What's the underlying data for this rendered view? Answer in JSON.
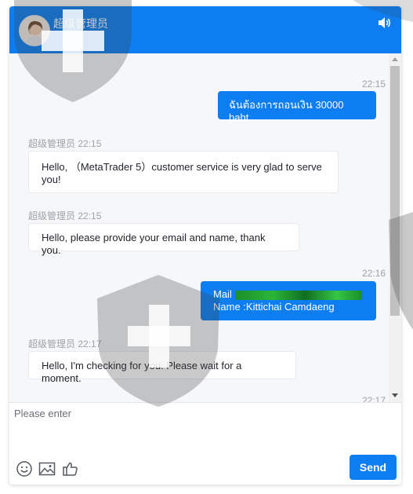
{
  "header": {
    "agent_name": "超级管理员",
    "sound_icon": "speaker-icon",
    "background": "#0d7ef2"
  },
  "messages": [
    {
      "side": "out",
      "time": "22:15",
      "text": "ฉันต้องการถอนเงิน 30000 baht."
    },
    {
      "side": "in",
      "sender": "超级管理员",
      "time": "22:15",
      "text": "Hello, （MetaTrader 5）customer service is very glad to serve you!"
    },
    {
      "side": "in",
      "sender": "超级管理员",
      "time": "22:15",
      "text": "Hello, please provide your email and name, thank you."
    },
    {
      "side": "out",
      "time": "22:16",
      "line1_label": "Mail",
      "line1_value": "[redacted email]",
      "line2": "Name :Kittichai Camdaeng"
    },
    {
      "side": "in",
      "sender": "超级管理员",
      "time": "22:17",
      "text": "Hello, I'm checking for you. Please wait for a moment."
    },
    {
      "side": "out",
      "time": "22:17"
    }
  ],
  "composer": {
    "placeholder": "Please enter",
    "value": "",
    "tools": [
      "emoji-icon",
      "image-icon",
      "thumbs-up-icon"
    ],
    "send_label": "Send"
  },
  "colors": {
    "accent": "#0d7ef2",
    "chat_background": "#f6f7f8",
    "timestamp": "#9ea3a9"
  }
}
